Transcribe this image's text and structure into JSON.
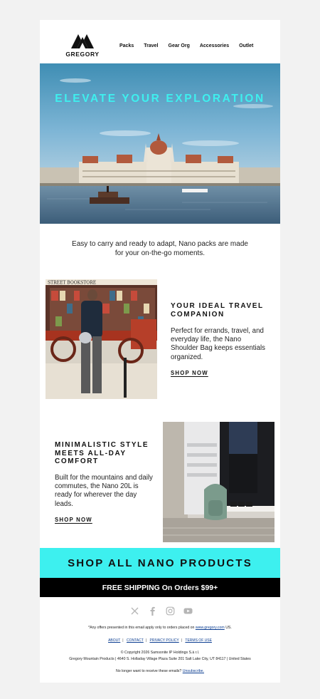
{
  "brand": {
    "logo_text": "GREGORY"
  },
  "nav": [
    "Packs",
    "Travel",
    "Gear Org",
    "Accessories",
    "Outlet"
  ],
  "hero": {
    "title": "ELEVATE YOUR EXPLORATION"
  },
  "intro": "Easy to carry and ready to adapt, Nano packs are made for your on-the-go moments.",
  "feature1": {
    "photo_sign": "STREET BOOKSTORE",
    "title": "YOUR IDEAL TRAVEL COMPANION",
    "text": "Perfect for errands, travel, and everyday life, the Nano Shoulder Bag keeps essentials organized.",
    "cta": "SHOP NOW"
  },
  "feature2": {
    "title": "MINIMALISTIC STYLE MEETS ALL-DAY COMFORT",
    "text": "Built for the mountains and daily commutes, the Nano 20L is ready for wherever the day leads.",
    "cta": "SHOP NOW"
  },
  "shop_all": "SHOP ALL NANO PRODUCTS",
  "shipping": "FREE SHIPPING On Orders $99+",
  "socials": [
    "x-icon",
    "facebook-icon",
    "instagram-icon",
    "youtube-icon"
  ],
  "footer": {
    "disclaimer_prefix": "*Any offers presented in this email apply only to orders placed on",
    "disclaimer_link": "www.gregory.com",
    "disclaimer_suffix": "US.",
    "links": [
      "ABOUT",
      "CONTACT",
      "PRIVACY POLICY",
      "TERMS OF USE"
    ],
    "copyright": "© Copyright 2026 Samsonite IP Holdings S.à r.l.",
    "address": "Gregory Mountain Products | 4640 S. Holladay Village Plaza Suite 201 Salt Lake City, UT 84117 | United States",
    "unsubscribe_prefix": "No longer want to receive these emails?",
    "unsubscribe_link": "Unsubscribe."
  },
  "colors": {
    "accent": "#3df0ef",
    "hero_title": "#3ef0ef",
    "shipping_bg": "#000000"
  }
}
